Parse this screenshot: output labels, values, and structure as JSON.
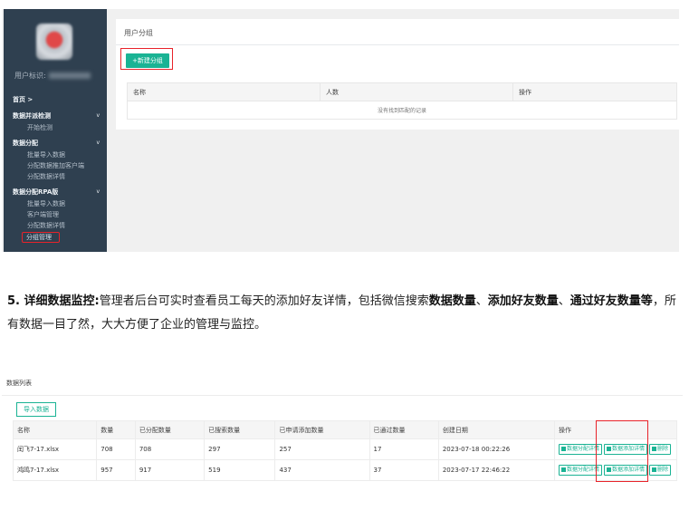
{
  "screen1": {
    "sidebar": {
      "user_label": "用户标识:",
      "groups": [
        {
          "label": "首页 >",
          "chevron": "",
          "items": []
        },
        {
          "label": "数据并派检测",
          "chevron": "v",
          "items": [
            "开始检测"
          ]
        },
        {
          "label": "数据分配",
          "chevron": "v",
          "items": [
            "批量导入数据",
            "分配数据推加客户端",
            "分配数据详情"
          ]
        },
        {
          "label": "数据分配RPA版",
          "chevron": "v",
          "items": [
            "批量导入数据",
            "客户端管理",
            "分配数据详情"
          ]
        }
      ],
      "highlighted_item": "分组管理"
    },
    "panel": {
      "title": "用户分组",
      "new_button": "+新建分组",
      "columns": [
        "名称",
        "人数",
        "操作"
      ],
      "empty_text": "没有找到匹配的记录"
    }
  },
  "paragraph": {
    "num": "5. ",
    "t1": "详细数据监控:",
    "t2": "管理者后台可实时查看员工每天的添加好友详情，包括微信搜索",
    "t3": "数据数量",
    "t4": "、",
    "t5": "添加好友数量",
    "t6": "、",
    "t7": "通过好友数量等",
    "t8": "，所有数据一目了然，大大方便了企业的管理与监控。"
  },
  "screen2": {
    "title": "数据列表",
    "import_button": "导入数据",
    "columns": [
      "名称",
      "数量",
      "已分配数量",
      "已搜索数量",
      "已申请添加数量",
      "已通过数量",
      "创建日期",
      "操作"
    ],
    "rows": [
      {
        "name": "闰飞7-17.xlsx",
        "count": "708",
        "allocated": "708",
        "searched": "297",
        "applied": "257",
        "passed": "17",
        "created": "2023-07-18 00:22:26"
      },
      {
        "name": "鸿鸣7-17.xlsx",
        "count": "957",
        "allocated": "917",
        "searched": "519",
        "applied": "437",
        "passed": "37",
        "created": "2023-07-17 22:46:22"
      }
    ],
    "actions": [
      "数据分配详情",
      "数据添加详情",
      "删除"
    ]
  }
}
